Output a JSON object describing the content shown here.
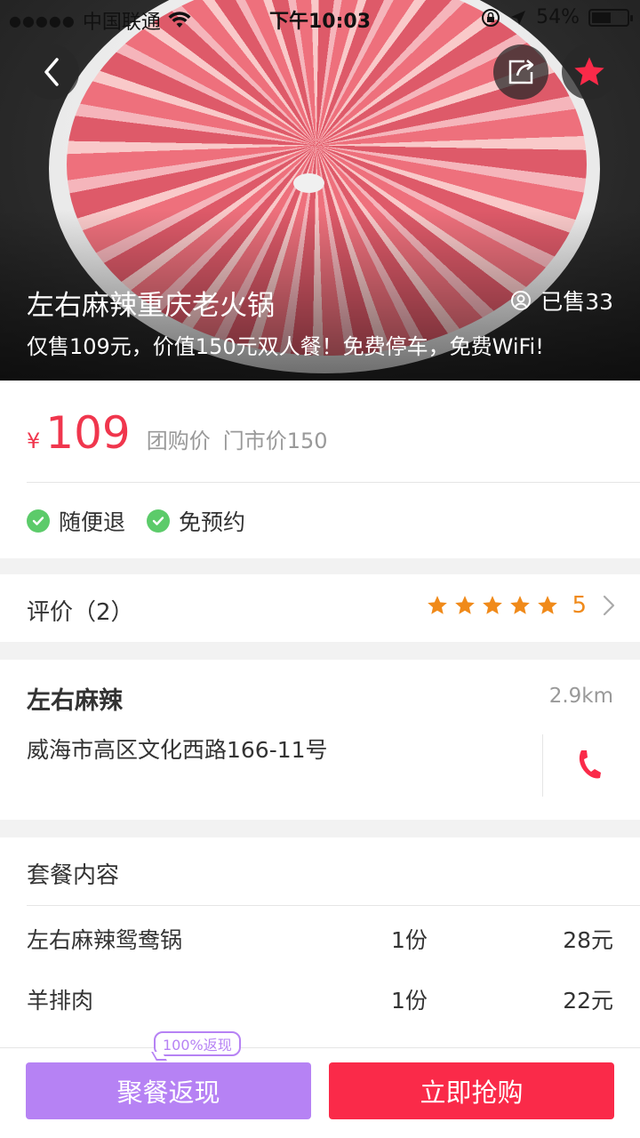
{
  "status_bar": {
    "signal_dots": "●●●●●",
    "carrier": "中国联通",
    "time": "下午10:03",
    "battery_percent": "54%",
    "battery_level": 0.54
  },
  "hero": {
    "title": "左右麻辣重庆老火锅",
    "sold": "已售33",
    "subtitle": "仅售109元，价值150元双人餐！免费停车，免费WiFi!"
  },
  "price": {
    "currency": "¥",
    "value": "109",
    "label": "团购价",
    "market_price": "门市价150"
  },
  "tags": [
    "随便退",
    "免预约"
  ],
  "review": {
    "label": "评价（2）",
    "stars": 5,
    "rating": "5"
  },
  "shop": {
    "name": "左右麻辣",
    "distance": "2.9km",
    "address": "威海市高区文化西路166-11号"
  },
  "package": {
    "title": "套餐内容",
    "items": [
      {
        "name": "左右麻辣鸳鸯锅",
        "qty": "1份",
        "price": "28元"
      },
      {
        "name": "羊排肉",
        "qty": "1份",
        "price": "22元"
      }
    ]
  },
  "actions": {
    "cashback_badge": "100%返现",
    "cashback_label": "聚餐返现",
    "buy_label": "立即抢购"
  },
  "colors": {
    "accent_red": "#fa2a49",
    "price_red": "#f0364d",
    "purple": "#b682f4",
    "star_orange": "#f08a1a",
    "check_green": "#5ccb6a"
  }
}
